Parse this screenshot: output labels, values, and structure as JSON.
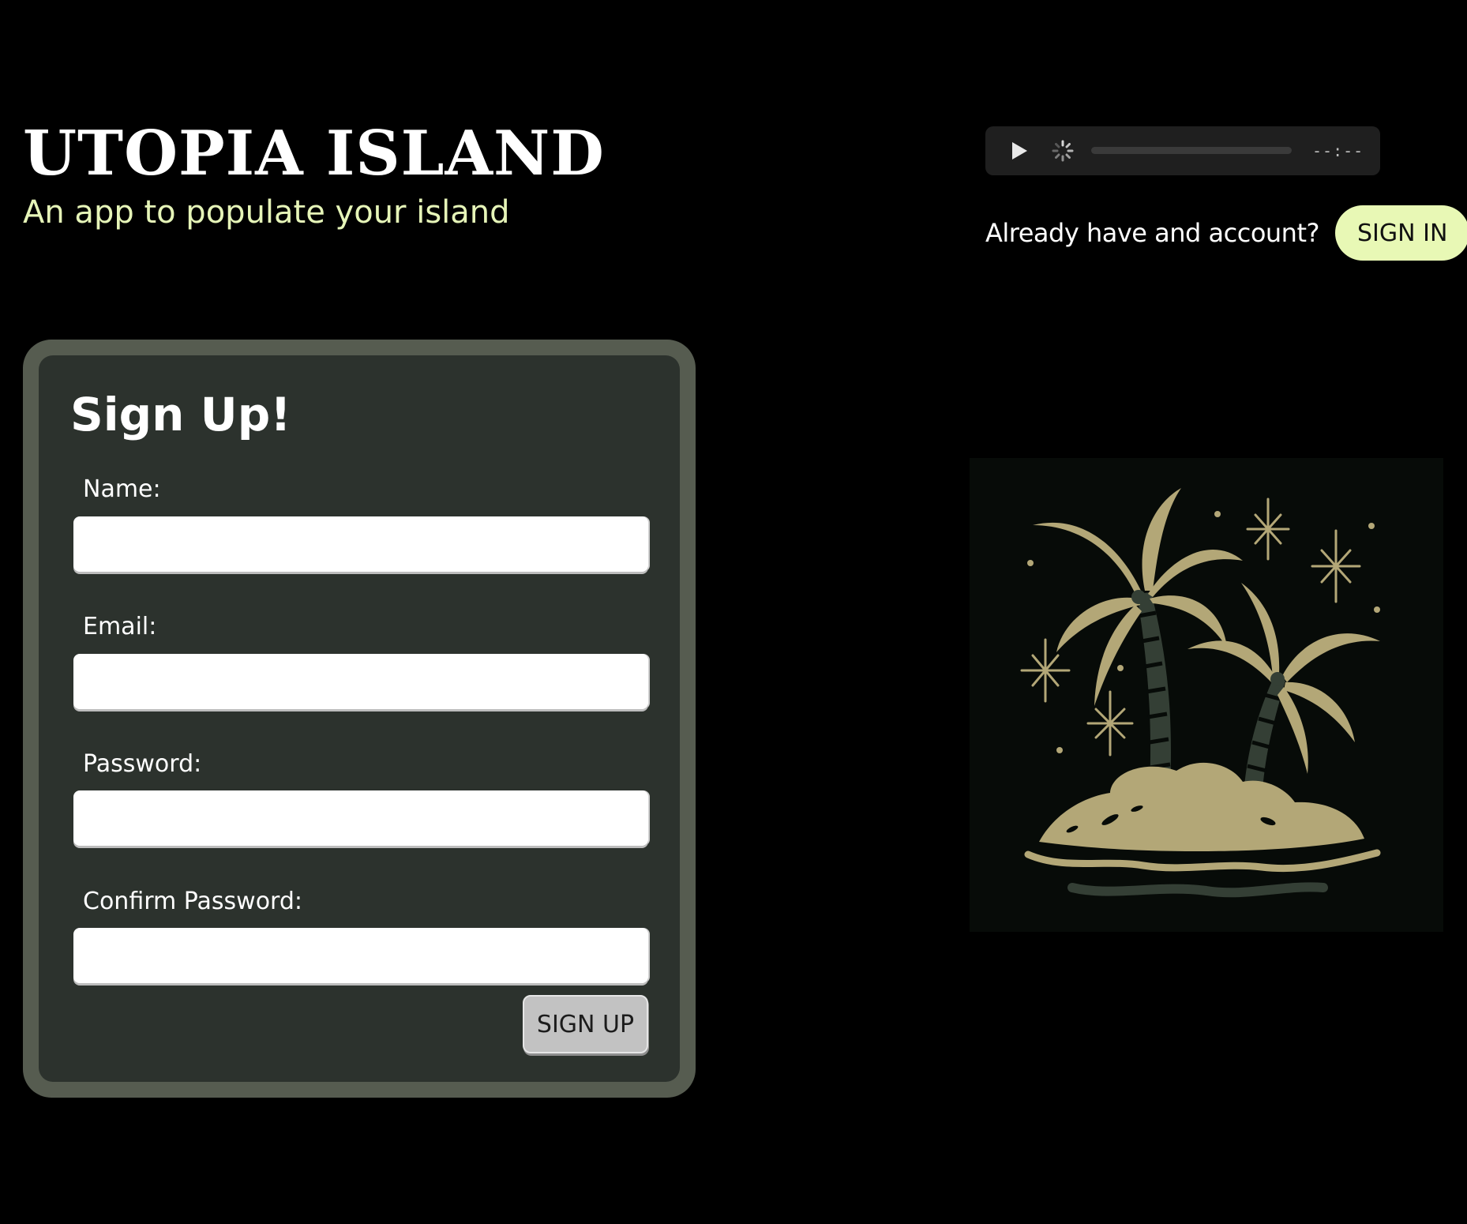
{
  "header": {
    "title": "UTOPIA ISLAND",
    "tagline": "An app to populate your island"
  },
  "audio_player": {
    "play_icon": "play-icon",
    "status_icon": "loading-spinner-icon",
    "progress": 0,
    "time": "--:--"
  },
  "signin": {
    "prompt": "Already have and account?",
    "button_label": "SIGN IN"
  },
  "signup_form": {
    "title": "Sign Up!",
    "fields": {
      "name": {
        "label": "Name:",
        "value": ""
      },
      "email": {
        "label": "Email:",
        "value": ""
      },
      "password": {
        "label": "Password:",
        "value": ""
      },
      "confirm_password": {
        "label": "Confirm Password:",
        "value": ""
      }
    },
    "submit_label": "SIGN UP"
  },
  "illustration": {
    "subject": "palm-trees-island-icon"
  },
  "colors": {
    "background": "#000000",
    "accent": "#e8f8b5",
    "tagline": "#e6f5b8",
    "card_border": "#565c50",
    "card_fill": "#2c322d",
    "illustration_gold": "#b3a777",
    "illustration_green": "#343f35"
  }
}
